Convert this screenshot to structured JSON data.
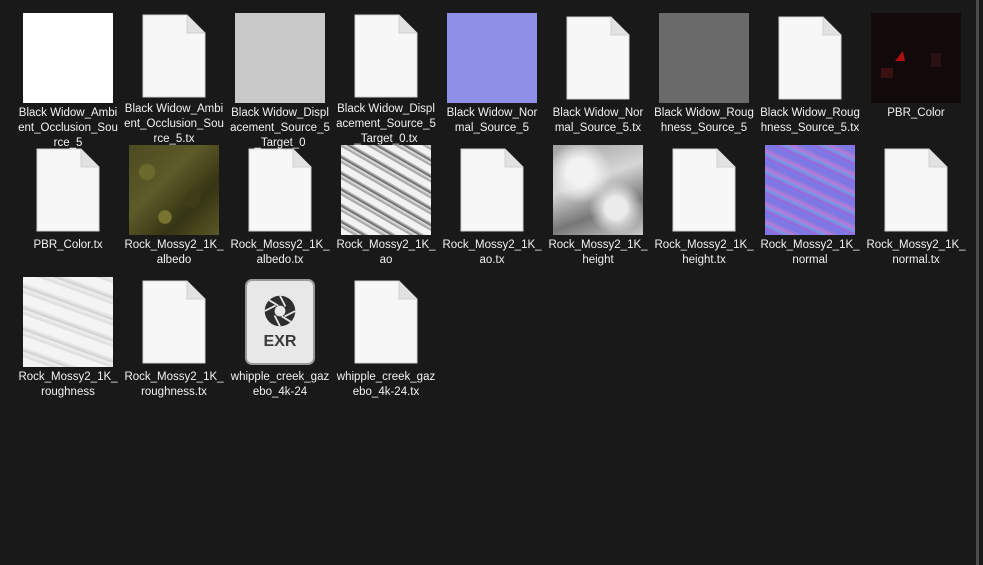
{
  "files": [
    {
      "name": "Black Widow_Ambient_Occlusion_Source_5",
      "thumb": "tex-ao5"
    },
    {
      "name": "Black Widow_Ambient_Occlusion_Source_5.tx",
      "thumb": "doc"
    },
    {
      "name": "Black Widow_Displacement_Source_5_Target_0",
      "thumb": "tex-disp"
    },
    {
      "name": "Black Widow_Displacement_Source_5_Target_0.tx",
      "thumb": "doc"
    },
    {
      "name": "Black Widow_Normal_Source_5",
      "thumb": "tex-normal"
    },
    {
      "name": "Black Widow_Normal_Source_5.tx",
      "thumb": "doc"
    },
    {
      "name": "Black Widow_Roughness_Source_5",
      "thumb": "tex-rough5"
    },
    {
      "name": "Black Widow_Roughness_Source_5.tx",
      "thumb": "doc"
    },
    {
      "name": "PBR_Color",
      "thumb": "tex-pbr"
    },
    {
      "name": "PBR_Color.tx",
      "thumb": "doc"
    },
    {
      "name": "Rock_Mossy2_1K_albedo",
      "thumb": "tex-albedo"
    },
    {
      "name": "Rock_Mossy2_1K_albedo.tx",
      "thumb": "doc"
    },
    {
      "name": "Rock_Mossy2_1K_ao",
      "thumb": "tex-ao"
    },
    {
      "name": "Rock_Mossy2_1K_ao.tx",
      "thumb": "doc"
    },
    {
      "name": "Rock_Mossy2_1K_height",
      "thumb": "tex-height"
    },
    {
      "name": "Rock_Mossy2_1K_height.tx",
      "thumb": "doc"
    },
    {
      "name": "Rock_Mossy2_1K_normal",
      "thumb": "tex-normal2"
    },
    {
      "name": "Rock_Mossy2_1K_normal.tx",
      "thumb": "doc"
    },
    {
      "name": "Rock_Mossy2_1K_roughness",
      "thumb": "tex-rough"
    },
    {
      "name": "Rock_Mossy2_1K_roughness.tx",
      "thumb": "doc"
    },
    {
      "name": "whipple_creek_gazebo_4k-24",
      "thumb": "exr",
      "badge": "EXR"
    },
    {
      "name": "whipple_creek_gazebo_4k-24.tx",
      "thumb": "doc"
    }
  ],
  "colors": {
    "background": "#191919",
    "text": "#ffffff"
  }
}
